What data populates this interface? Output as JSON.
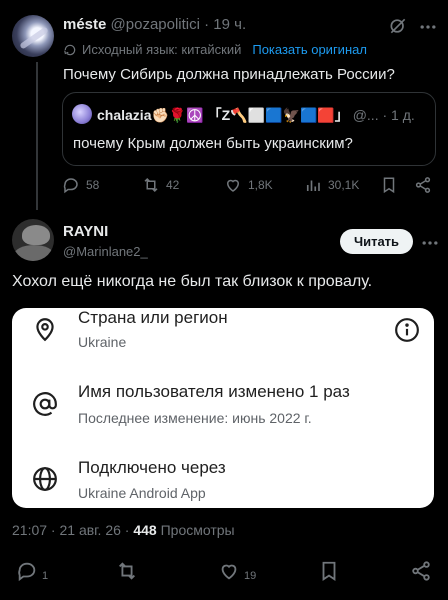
{
  "tweet1": {
    "name": "méste",
    "handle": "@pozapolitici",
    "time": "· 19 ч.",
    "translation_note": "Исходный язык: китайский",
    "show_original": "Показать оригинал",
    "text": "Почему Сибирь должна принадлежать России?",
    "quote": {
      "name": "chalazia✊🏻🌹☮️ 「Z🪓⬜🟦🦅🟦🟥」",
      "handle": "@...",
      "time": "· 1 д.",
      "text": "почему Крым должен быть украинским?"
    },
    "actions": {
      "replies": "58",
      "reposts": "42",
      "likes": "1,8K",
      "views": "30,1K"
    }
  },
  "tweet2": {
    "name": "RAYNI",
    "handle": "@Marinlane2_",
    "follow_label": "Читать",
    "text": "Хохол ещё никогда не был так близок к провалу.",
    "card": {
      "country_title": "Страна или регион",
      "country_value": "Ukraine",
      "username_title": "Имя пользователя изменено 1 раз",
      "username_value": "Последнее изменение: июнь 2022 г.",
      "connected_title": "Подключено через",
      "connected_value": "Ukraine Android App"
    },
    "meta_time": "21:07 · 21 авг. 26 ·",
    "meta_views_count": "448",
    "meta_views_label": "Просмотры",
    "actions": {
      "replies": "1",
      "likes": "19"
    }
  },
  "colors": {
    "background": "#000000",
    "text": "#e7e9ea",
    "muted": "#71767b",
    "accent": "#1d9bf0",
    "card_bg": "#ffffff"
  },
  "icons": [
    "grok-icon",
    "more-icon",
    "translate-icon",
    "reply-icon",
    "repost-icon",
    "like-icon",
    "views-icon",
    "bookmark-icon",
    "share-icon",
    "location-pin-icon",
    "info-icon",
    "at-sign-icon",
    "globe-icon"
  ]
}
